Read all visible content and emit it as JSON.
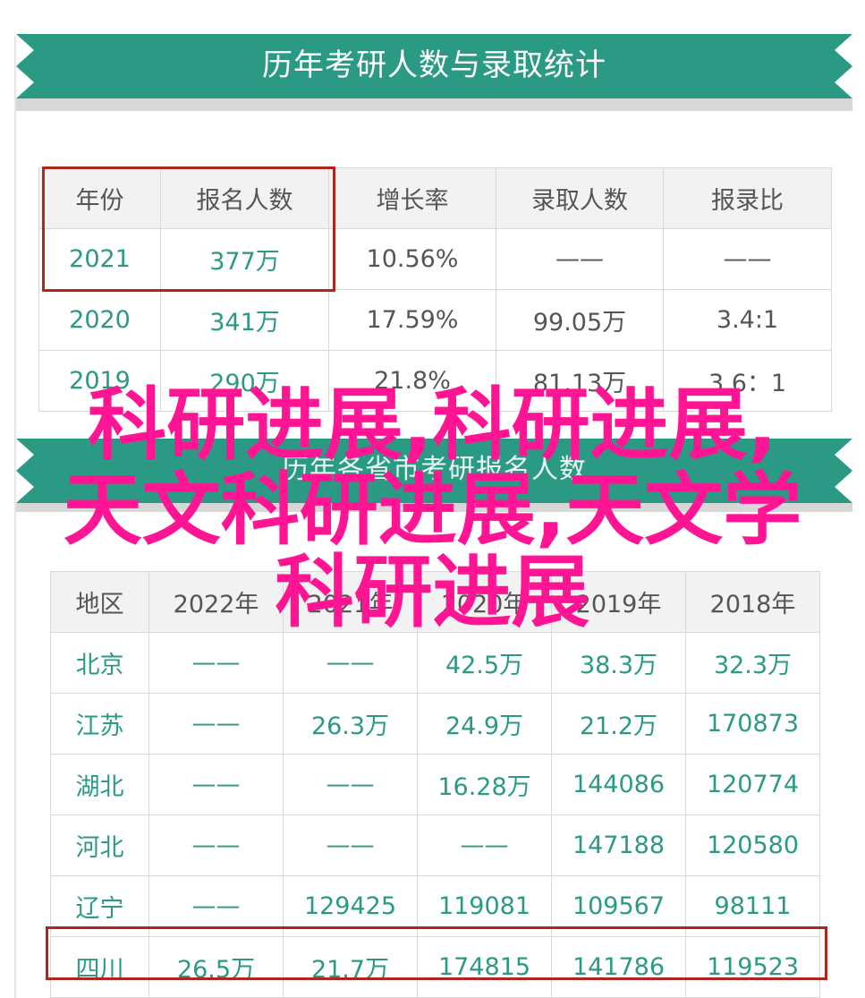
{
  "section1": {
    "title": "历年考研人数与录取统计",
    "headers": [
      "年份",
      "报名人数",
      "增长率",
      "录取人数",
      "报录比"
    ],
    "rows": [
      [
        "2021",
        "377万",
        "10.56%",
        "——",
        "——"
      ],
      [
        "2020",
        "341万",
        "17.59%",
        "99.05万",
        "3.4:1"
      ],
      [
        "2019",
        "290万",
        "21.8%",
        "81.13万",
        "3.6：1"
      ]
    ]
  },
  "section2": {
    "title": "历年各省市考研报名人数",
    "headers": [
      "地区",
      "2022年",
      "2021年",
      "2020年",
      "2019年",
      "2018年"
    ],
    "rows": [
      [
        "北京",
        "——",
        "——",
        "42.5万",
        "38.3万",
        "32.3万"
      ],
      [
        "江苏",
        "——",
        "26.3万",
        "24.9万",
        "21.2万",
        "170873"
      ],
      [
        "湖北",
        "——",
        "——",
        "16.28万",
        "144086",
        "120774"
      ],
      [
        "河北",
        "——",
        "——",
        "——",
        "147188",
        "120580"
      ],
      [
        "辽宁",
        "——",
        "129425",
        "119081",
        "109567",
        "98111"
      ],
      [
        "四川",
        "26.5万",
        "21.7万",
        "174815",
        "141786",
        "119523"
      ]
    ]
  },
  "overlay": {
    "line1": "科研进展,科研进展,",
    "line2": "天文科研进展,天文学",
    "line3": "科研进展"
  },
  "colors": {
    "accent": "#2a9a85",
    "highlight": "#b0261a",
    "overlay": "#ff1493"
  }
}
